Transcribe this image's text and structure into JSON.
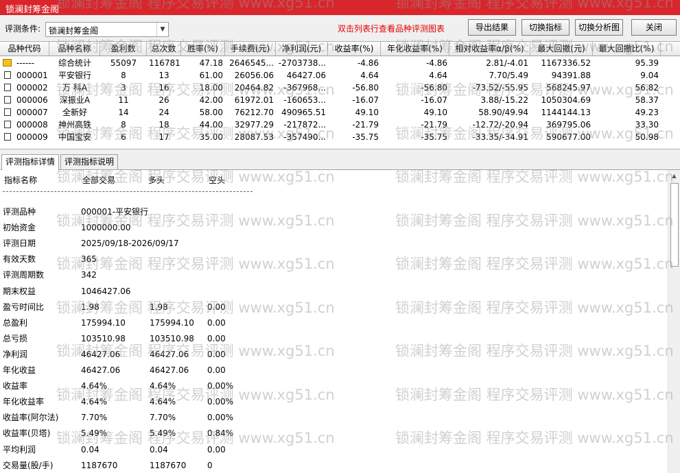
{
  "window": {
    "title": "锁澜封筹金阁"
  },
  "toolbar": {
    "condition_label": "评测条件:",
    "condition_value": "锁澜封筹金阁",
    "hint": "双击列表行查看品种评测图表",
    "btn_export": "导出结果",
    "btn_switch_indicator": "切换指标",
    "btn_switch_chart": "切换分析图",
    "btn_close": "关闭"
  },
  "grid": {
    "headers": [
      "品种代码",
      "品种名称",
      "盈利数",
      "总次数",
      "胜率(%)",
      "手续费(元)",
      "净利润(元)",
      "收益率(%)",
      "年化收益率(%)",
      "相对收益率α/β(%)",
      "最大回撤(元)",
      "最大回撤比(%)"
    ],
    "rows": [
      {
        "code": "------",
        "name": "综合统计",
        "win": "55097",
        "total": "116781",
        "rate": "47.18",
        "fee": "2646545...",
        "profit": "-2703738...",
        "ret": "-4.86",
        "annual": "-4.86",
        "ab": "2.81/-4.01",
        "dd": "1167336.52",
        "ddr": "95.39",
        "icon": "folder"
      },
      {
        "code": "000001",
        "name": "平安银行",
        "win": "8",
        "total": "13",
        "rate": "61.00",
        "fee": "26056.06",
        "profit": "46427.06",
        "ret": "4.64",
        "annual": "4.64",
        "ab": "7.70/5.49",
        "dd": "94391.88",
        "ddr": "9.04",
        "icon": "doc"
      },
      {
        "code": "000002",
        "name": "万 科A",
        "win": "3",
        "total": "16",
        "rate": "18.00",
        "fee": "20464.82",
        "profit": "-367968...",
        "ret": "-56.80",
        "annual": "-56.80",
        "ab": "-73.52/-55.95",
        "dd": "568245.97",
        "ddr": "56.82",
        "icon": "doc"
      },
      {
        "code": "000006",
        "name": "深振业A",
        "win": "11",
        "total": "26",
        "rate": "42.00",
        "fee": "61972.01",
        "profit": "-160653...",
        "ret": "-16.07",
        "annual": "-16.07",
        "ab": "3.88/-15.22",
        "dd": "1050304.69",
        "ddr": "58.37",
        "icon": "doc"
      },
      {
        "code": "000007",
        "name": "全新好",
        "win": "14",
        "total": "24",
        "rate": "58.00",
        "fee": "76212.70",
        "profit": "490965.51",
        "ret": "49.10",
        "annual": "49.10",
        "ab": "58.90/49.94",
        "dd": "1144144.13",
        "ddr": "49.23",
        "icon": "doc"
      },
      {
        "code": "000008",
        "name": "神州高铁",
        "win": "8",
        "total": "18",
        "rate": "44.00",
        "fee": "32977.29",
        "profit": "-217872...",
        "ret": "-21.79",
        "annual": "-21.79",
        "ab": "-12.72/-20.94",
        "dd": "369795.06",
        "ddr": "33.30",
        "icon": "doc"
      },
      {
        "code": "000009",
        "name": "中国宝安",
        "win": "6",
        "total": "17",
        "rate": "35.00",
        "fee": "28087.53",
        "profit": "-357490...",
        "ret": "-35.75",
        "annual": "-35.75",
        "ab": "-33.35/-34.91",
        "dd": "590677.00",
        "ddr": "50.98",
        "icon": "doc"
      }
    ]
  },
  "tabs": [
    "评测指标详情",
    "评测指标说明"
  ],
  "detail": {
    "header": [
      "指标名称",
      "全部交易",
      "多头",
      "空头"
    ],
    "separator": "------------------------------------------------------------------------------------------",
    "rows": [
      {
        "label": "评测品种",
        "c1": "000001-平安银行",
        "c2": "",
        "c3": ""
      },
      {
        "label": "初始资金",
        "c1": "1000000.00",
        "c2": "",
        "c3": ""
      },
      {
        "label": "评测日期",
        "c1": "2025/09/18-2026/09/17",
        "c2": "",
        "c3": ""
      },
      {
        "label": "有效天数",
        "c1": "365",
        "c2": "",
        "c3": ""
      },
      {
        "label": "评测周期数",
        "c1": "342",
        "c2": "",
        "c3": ""
      },
      {
        "label": "期末权益",
        "c1": "1046427.06",
        "c2": "",
        "c3": ""
      },
      {
        "label": "盈亏时间比",
        "c1": "1.98",
        "c2": "1.98",
        "c3": "0.00"
      },
      {
        "label": "总盈利",
        "c1": "175994.10",
        "c2": "175994.10",
        "c3": "0.00"
      },
      {
        "label": "总亏损",
        "c1": "103510.98",
        "c2": "103510.98",
        "c3": "0.00"
      },
      {
        "label": "净利润",
        "c1": "46427.06",
        "c2": "46427.06",
        "c3": "0.00"
      },
      {
        "label": "年化收益",
        "c1": "46427.06",
        "c2": "46427.06",
        "c3": "0.00"
      },
      {
        "label": "收益率",
        "c1": "4.64%",
        "c2": "4.64%",
        "c3": "0.00%"
      },
      {
        "label": "年化收益率",
        "c1": "4.64%",
        "c2": "4.64%",
        "c3": "0.00%"
      },
      {
        "label": "收益率(阿尔法)",
        "c1": "7.70%",
        "c2": "7.70%",
        "c3": "0.00%"
      },
      {
        "label": "收益率(贝塔)",
        "c1": "5.49%",
        "c2": "5.49%",
        "c3": "0.84%"
      },
      {
        "label": "平均利润",
        "c1": "0.04",
        "c2": "0.04",
        "c3": "0.00"
      },
      {
        "label": "交易量(股/手)",
        "c1": "1187670",
        "c2": "1187670",
        "c3": "0"
      }
    ]
  },
  "watermark": "锁澜封筹金阁 程序交易评测 www.xg51.cn",
  "colors": {
    "titlebar": "#d9262c",
    "hint": "#e00000"
  }
}
